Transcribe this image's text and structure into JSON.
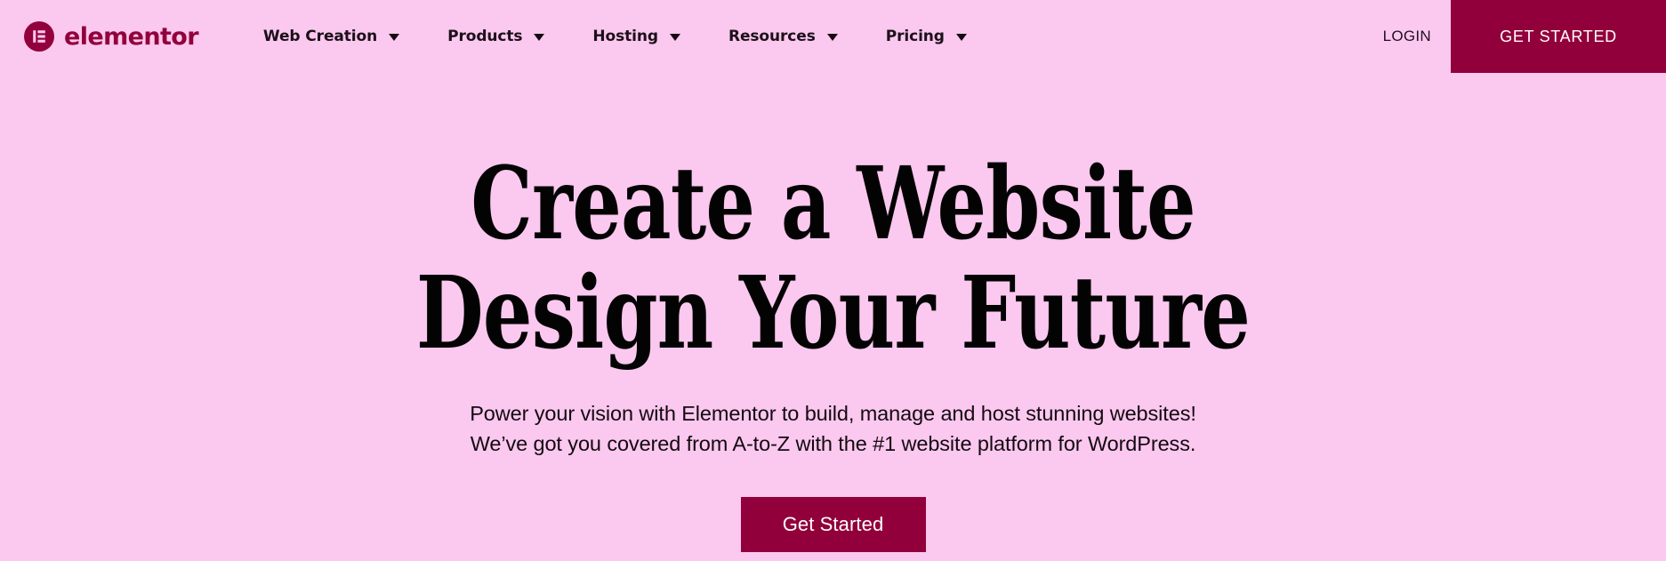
{
  "brand": {
    "name": "elementor",
    "logo_icon": "elementor-logo-icon",
    "color": "#92003b"
  },
  "header": {
    "nav_items": [
      {
        "label": "Web Creation",
        "has_dropdown": true,
        "icon": "chevron-down-icon"
      },
      {
        "label": "Products",
        "has_dropdown": true,
        "icon": "chevron-down-icon"
      },
      {
        "label": "Hosting",
        "has_dropdown": true,
        "icon": "chevron-down-icon"
      },
      {
        "label": "Resources",
        "has_dropdown": true,
        "icon": "chevron-down-icon"
      },
      {
        "label": "Pricing",
        "has_dropdown": true,
        "icon": "chevron-down-icon"
      }
    ],
    "login_label": "LOGIN",
    "cta_label": "GET STARTED",
    "cta_color": "#92003b",
    "background_color": "#fbc8ef"
  },
  "hero": {
    "title_line_1": "Create a Website",
    "title_line_2": "Design Your Future",
    "subtitle_line_1": "Power your vision with Elementor to build, manage and host stunning websites!",
    "subtitle_line_2": "We’ve got you covered from A-to-Z with the #1 website platform for WordPress.",
    "cta_label": "Get Started",
    "cta_color": "#92003b",
    "text_color": "#030303",
    "background_color": "#fbc8ef"
  }
}
